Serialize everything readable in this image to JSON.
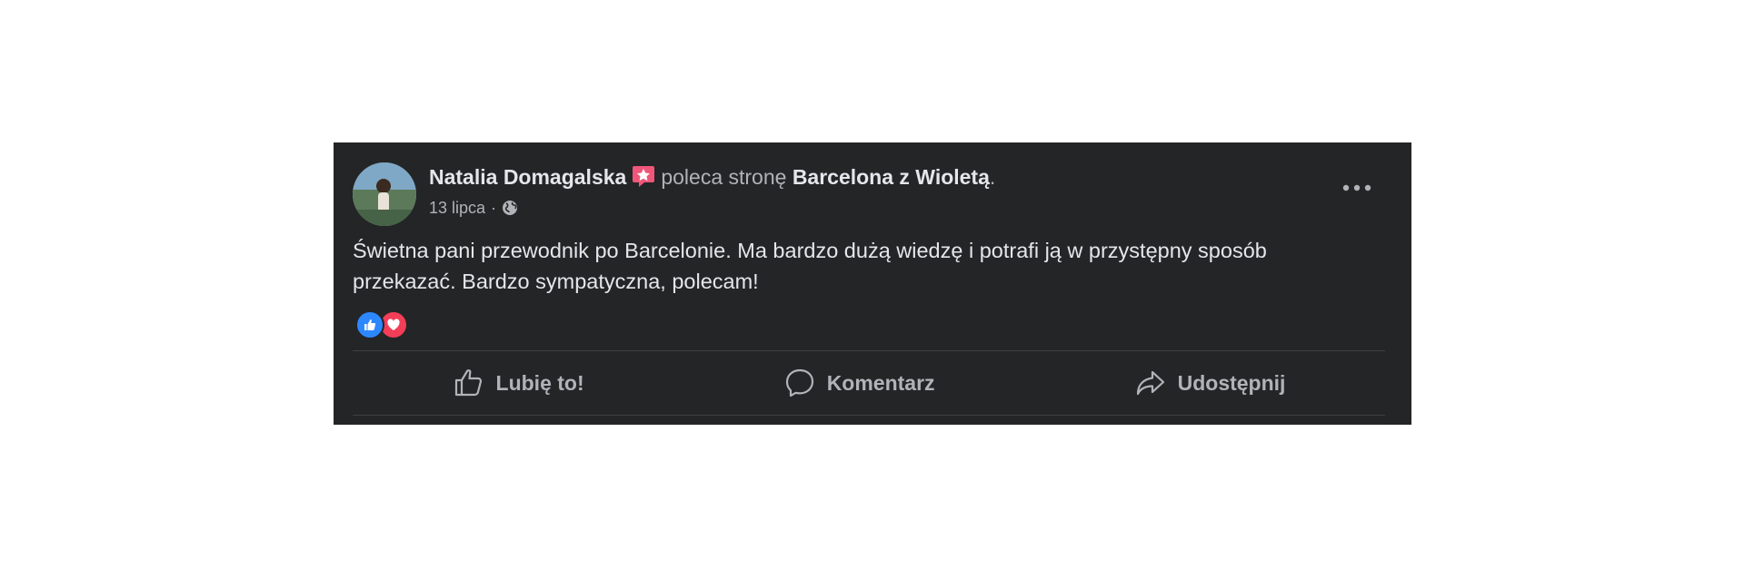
{
  "post": {
    "author": "Natalia Domagalska",
    "verb": "poleca stronę",
    "page": "Barcelona z Wioletą",
    "end_punct": ".",
    "date": "13 lipca",
    "separator": "·",
    "privacy_icon": "globe-icon",
    "recommend_icon": "recommend-star-icon",
    "text_line_1": "Świetna pani przewodnik po Barcelonie. Ma bardzo dużą wiedzę i potrafi ją w przystępny sposób",
    "text_line_2": "przekazać. Bardzo sympatyczna, polecam!",
    "reactions": [
      "like",
      "love"
    ]
  },
  "actions": {
    "like_label": "Lubię to!",
    "comment_label": "Komentarz",
    "share_label": "Udostępnij"
  },
  "colors": {
    "card_bg": "#242526",
    "text_primary": "#e4e6eb",
    "text_secondary": "#b0b3b8",
    "like_blue": "#2d88ff",
    "love_red": "#f33e58",
    "recommend_pink": "#f0567a"
  }
}
